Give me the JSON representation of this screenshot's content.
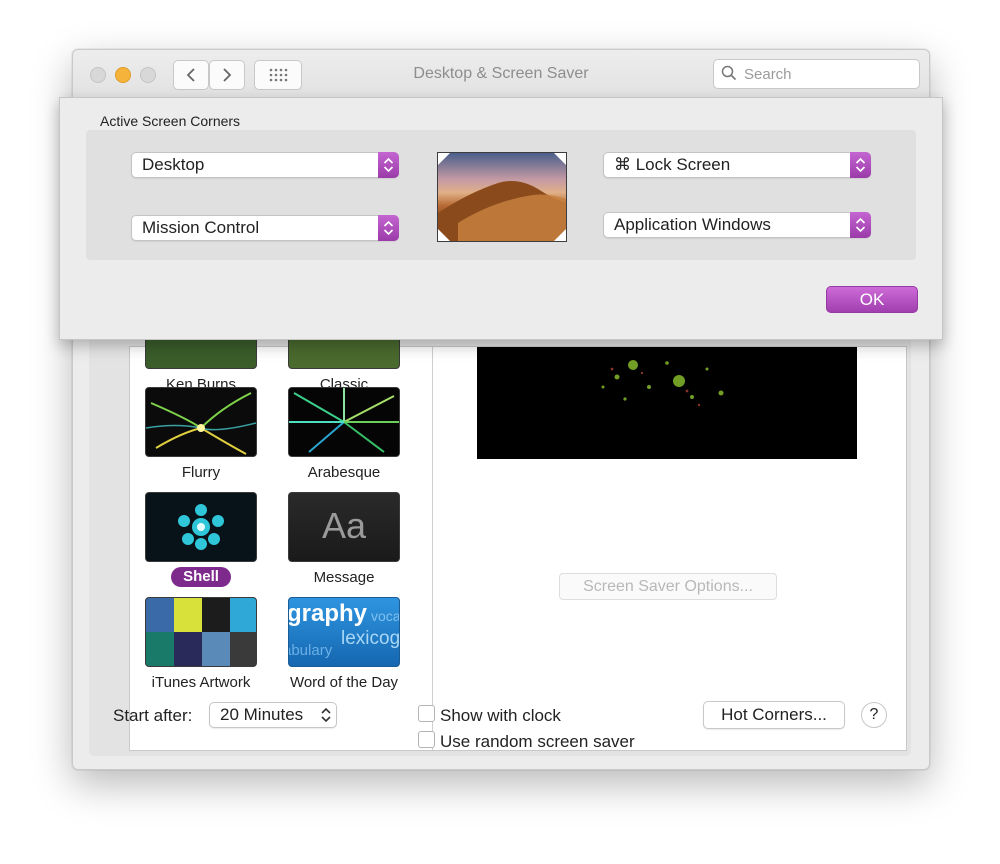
{
  "window": {
    "title": "Desktop & Screen Saver",
    "search_placeholder": "Search"
  },
  "hot_corners_sheet": {
    "title": "Active Screen Corners",
    "top_left": "Desktop",
    "bottom_left": "Mission Control",
    "top_right": "⌘ Lock Screen",
    "bottom_right": "Application Windows",
    "ok_label": "OK"
  },
  "screen_savers": {
    "items": [
      {
        "label": "Ken Burns"
      },
      {
        "label": "Classic"
      },
      {
        "label": "Flurry"
      },
      {
        "label": "Arabesque"
      },
      {
        "label": "Shell",
        "selected": true
      },
      {
        "label": "Message"
      },
      {
        "label": "iTunes Artwork"
      },
      {
        "label": "Word of the Day"
      }
    ],
    "message_thumb_text": "Aa",
    "word_thumb_text": [
      "graphy",
      "voca",
      "lexicog",
      "abulary"
    ]
  },
  "preview": {
    "options_button": "Screen Saver Options..."
  },
  "bottom_bar": {
    "start_after_label": "Start after:",
    "start_after_value": "20 Minutes",
    "show_with_clock": "Show with clock",
    "use_random": "Use random screen saver",
    "hot_corners_button": "Hot Corners...",
    "help_label": "?"
  },
  "colors": {
    "accent": "#a94bb6",
    "selection": "#7d2a8c"
  }
}
